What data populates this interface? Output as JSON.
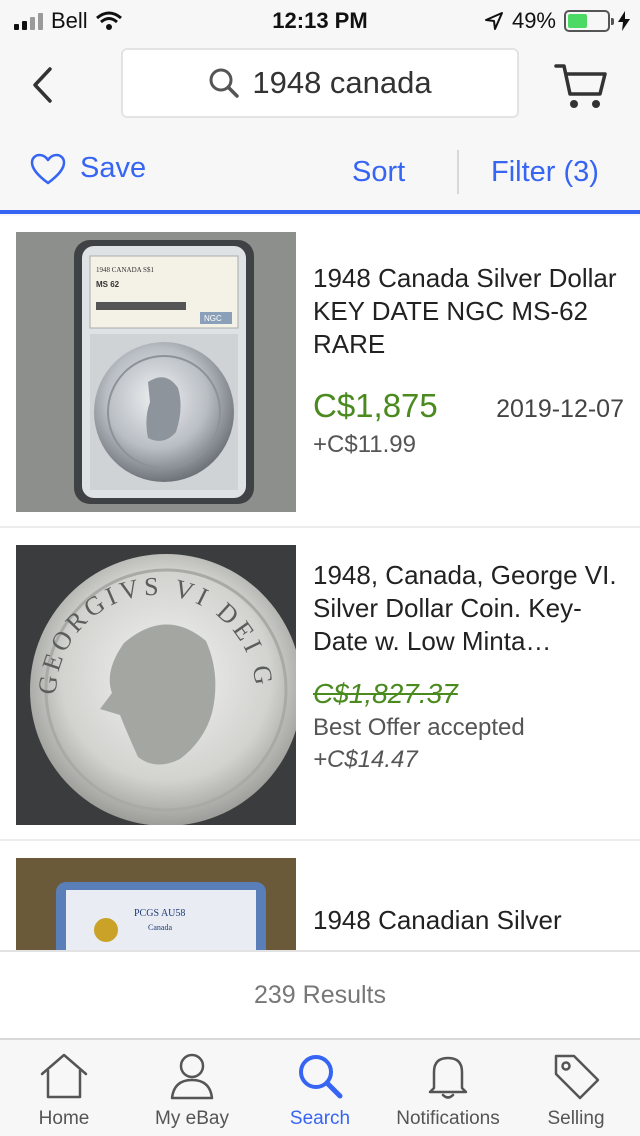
{
  "status": {
    "carrier": "Bell",
    "time": "12:13 PM",
    "battery": "49%"
  },
  "header": {
    "search_query": "1948 canada"
  },
  "toolbar": {
    "save_label": "Save",
    "sort_label": "Sort",
    "filter_label": "Filter (3)"
  },
  "results": [
    {
      "title": "1948 Canada Silver Dollar KEY DATE NGC MS-62 RARE",
      "price": "C$1,875",
      "date": "2019-12-07",
      "shipping": "+C$11.99",
      "slab_label": "1948 CANADA S$1",
      "slab_grade": "MS 62",
      "slab_brand": "NGC"
    },
    {
      "title": "1948, Canada, George VI. Silver Dollar Coin. Key-Date w. Low Minta…",
      "price": "C$1,827.37",
      "note": "Best Offer accepted",
      "shipping": "+C$14.47",
      "coin_legend": "GEORGIVS VI DEI GRATIA REX"
    },
    {
      "title": "1948 Canadian Silver",
      "slab_label": "PCGS AU58",
      "slab_sub": "Canada"
    }
  ],
  "results_count": "239 Results",
  "tabs": [
    {
      "label": "Home",
      "icon": "home-icon"
    },
    {
      "label": "My eBay",
      "icon": "user-icon"
    },
    {
      "label": "Search",
      "icon": "search-icon"
    },
    {
      "label": "Notifications",
      "icon": "bell-icon"
    },
    {
      "label": "Selling",
      "icon": "tag-icon"
    }
  ],
  "colors": {
    "accent": "#3665f3",
    "price": "#4a8a1f",
    "battery": "#4cd964"
  }
}
